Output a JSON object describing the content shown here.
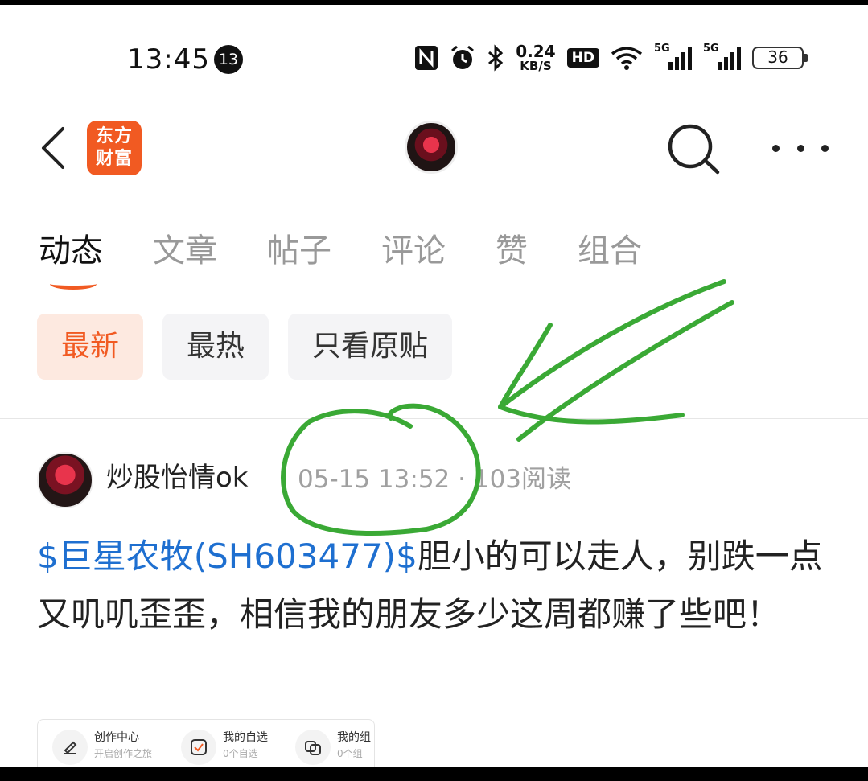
{
  "status_bar": {
    "time": "13:45",
    "notification_count": "13",
    "net_speed_value": "0.24",
    "net_speed_unit": "KB/S",
    "hd_label": "HD",
    "signal1_label": "5G",
    "signal2_label": "5G",
    "battery": "36"
  },
  "header": {
    "logo_line1": "东方",
    "logo_line2": "财富"
  },
  "tabs": [
    {
      "label": "动态",
      "active": true
    },
    {
      "label": "文章",
      "active": false
    },
    {
      "label": "帖子",
      "active": false
    },
    {
      "label": "评论",
      "active": false
    },
    {
      "label": "赞",
      "active": false
    },
    {
      "label": "组合",
      "active": false
    }
  ],
  "filters": [
    {
      "label": "最新",
      "active": true
    },
    {
      "label": "最热",
      "active": false
    },
    {
      "label": "只看原贴",
      "active": false
    }
  ],
  "post": {
    "author": "炒股怡情ok",
    "timestamp": "05-15 13:52",
    "separator": "·",
    "reads": "103阅读",
    "stock_link": "$巨星农牧(SH603477)$",
    "body": "胆小的可以走人，别跌一点又叽叽歪歪，相信我的朋友多少这周都赚了些吧！"
  },
  "embedded_card": {
    "items": [
      {
        "title": "创作中心",
        "subtitle": "开启创作之旅"
      },
      {
        "title": "我的自选",
        "subtitle": "0个自选"
      },
      {
        "title": "我的组",
        "subtitle": "0个组"
      }
    ]
  },
  "colors": {
    "brand_orange": "#f15a22",
    "stock_link_blue": "#1e6fd0",
    "annotation_green": "#3aa935"
  }
}
